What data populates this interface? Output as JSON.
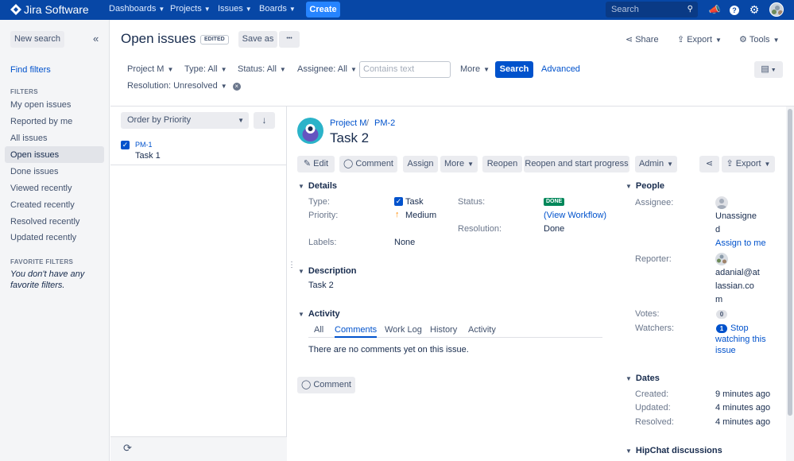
{
  "topnav": {
    "logo": "Jira Software",
    "menus": [
      "Dashboards",
      "Projects",
      "Issues",
      "Boards"
    ],
    "create_label": "Create",
    "search_placeholder": "Search"
  },
  "sidebar": {
    "new_search_label": "New search",
    "collapse_icon": "«",
    "find_filters": "Find filters",
    "filters_heading": "FILTERS",
    "items": [
      "My open issues",
      "Reported by me",
      "All issues",
      "Open issues",
      "Done issues",
      "Viewed recently",
      "Created recently",
      "Resolved recently",
      "Updated recently"
    ],
    "active_item": "Open issues",
    "favorite_heading": "FAVORITE FILTERS",
    "favorite_empty": "You don't have any favorite filters."
  },
  "header": {
    "title": "Open issues",
    "edited_badge": "EDITED",
    "save_as_label": "Save as",
    "more_icon": "•••",
    "share_label": "Share",
    "export_label": "Export",
    "tools_label": "Tools"
  },
  "filters": {
    "project": "Project M",
    "type": "Type: All",
    "status": "Status: All",
    "assignee": "Assignee: All",
    "contains_placeholder": "Contains text",
    "more": "More",
    "search_label": "Search",
    "advanced_label": "Advanced",
    "resolution": "Resolution: Unresolved"
  },
  "list": {
    "order_by": "Order by Priority",
    "sort_icon": "↓",
    "items": [
      {
        "key": "PM-1",
        "summary": "Task 1"
      }
    ],
    "refresh_icon": "⟳"
  },
  "issue": {
    "project_link": "Project M",
    "key_link": "PM-2",
    "title": "Task 2",
    "toolbar": {
      "edit": "Edit",
      "comment": "Comment",
      "assign": "Assign",
      "more": "More",
      "reopen": "Reopen",
      "reopen_start": "Reopen and start progress",
      "admin": "Admin",
      "export": "Export"
    },
    "details": {
      "heading": "Details",
      "type_label": "Type:",
      "type_value": "Task",
      "priority_label": "Priority:",
      "priority_value": "Medium",
      "labels_label": "Labels:",
      "labels_value": "None",
      "status_label": "Status:",
      "status_value": "DONE",
      "view_workflow": "(View Workflow)",
      "resolution_label": "Resolution:",
      "resolution_value": "Done"
    },
    "description": {
      "heading": "Description",
      "text": "Task 2"
    },
    "activity": {
      "heading": "Activity",
      "tabs": [
        "All",
        "Comments",
        "Work Log",
        "History",
        "Activity"
      ],
      "active_tab": "Comments",
      "empty_text": "There are no comments yet on this issue.",
      "comment_button": "Comment"
    },
    "people": {
      "heading": "People",
      "assignee_label": "Assignee:",
      "assignee_value_line1": "Unassigne",
      "assignee_value_line2": "d",
      "assign_to_me": "Assign to me",
      "reporter_label": "Reporter:",
      "reporter_line1": "adanial@at",
      "reporter_line2": "lassian.co",
      "reporter_line3": "m",
      "votes_label": "Votes:",
      "votes_count": "0",
      "watchers_label": "Watchers:",
      "watchers_count": "1",
      "stop_line1": "Stop",
      "stop_line2": "watching this",
      "stop_line3": "issue"
    },
    "dates": {
      "heading": "Dates",
      "created_label": "Created:",
      "created_value": "9 minutes ago",
      "updated_label": "Updated:",
      "updated_value": "4 minutes ago",
      "resolved_label": "Resolved:",
      "resolved_value": "4 minutes ago"
    },
    "hipchat_heading": "HipChat discussions"
  },
  "colors": {
    "nav_bg": "#0747a6",
    "primary": "#0052cc",
    "done_green": "#00875a",
    "sidebar_bg": "#f4f5f7"
  }
}
